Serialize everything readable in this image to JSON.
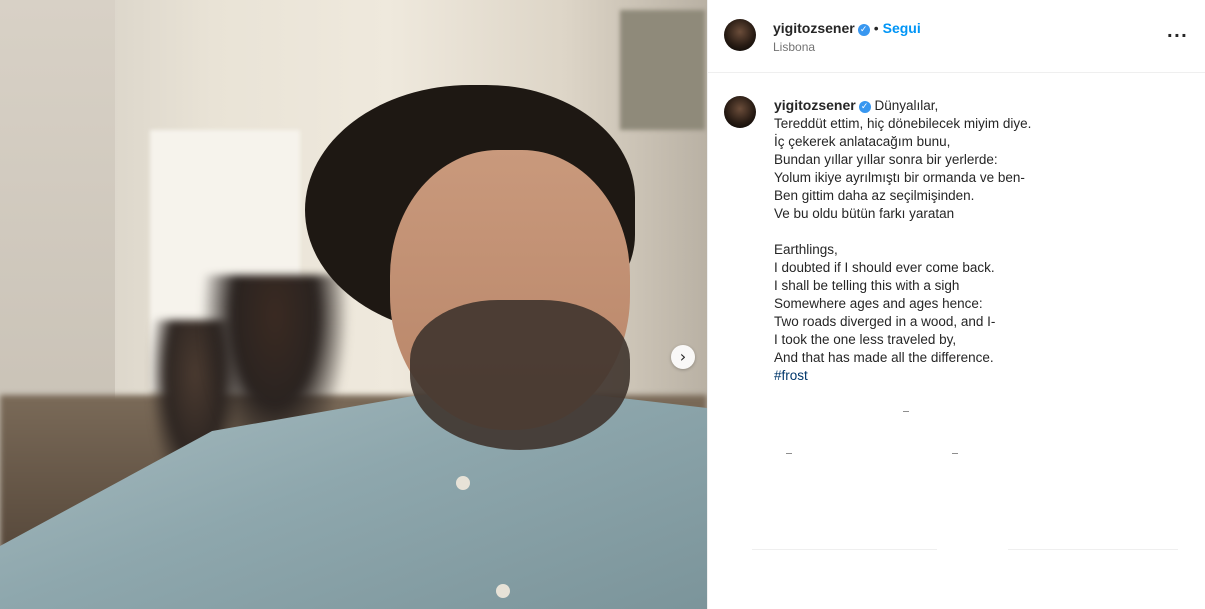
{
  "post": {
    "author": {
      "username": "yigitozsener",
      "verified_icon": "verified-badge-icon",
      "follow_label": "Segui",
      "location": "Lisbona"
    },
    "media": {
      "next_icon": "chevron-right-icon"
    },
    "caption": {
      "username": "yigitozsener",
      "first_line": "Dünyalılar,",
      "lines_tr": [
        "Tereddüt ettim, hiç dönebilecek miyim diye.",
        "İç çekerek anlatacağım bunu,",
        "Bundan yıllar yıllar sonra bir yerlerde:",
        "Yolum ikiye ayrılmıştı bir ormanda ve ben-",
        "Ben gittim daha az seçilmişinden.",
        "Ve bu oldu bütün farkı yaratan"
      ],
      "lines_en": [
        "Earthlings,",
        "I doubted if I should ever come back.",
        "I shall be telling this with a sigh",
        "Somewhere ages and ages hence:",
        "Two roads diverged in a wood, and I-",
        "I took the one less traveled by,",
        "And that has made all the difference."
      ],
      "hashtag": "#frost"
    },
    "more_icon": "more-options-icon"
  }
}
